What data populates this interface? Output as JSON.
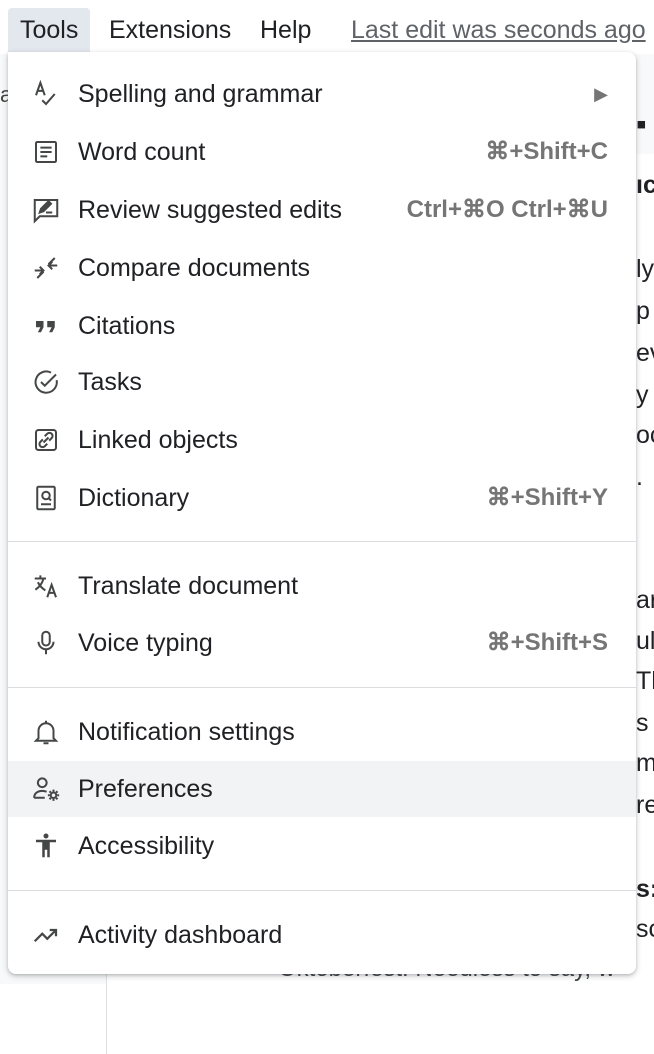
{
  "menubar": {
    "tools": "Tools",
    "extensions": "Extensions",
    "help": "Help",
    "last_edit": "Last edit was seconds ago"
  },
  "menu": {
    "items": [
      {
        "label": "Spelling and grammar",
        "shortcut": "",
        "icon": "spellcheck-icon",
        "submenu": true
      },
      {
        "label": "Word count",
        "shortcut": "⌘+Shift+C",
        "icon": "word-count-icon"
      },
      {
        "label": "Review suggested edits",
        "shortcut": "Ctrl+⌘O Ctrl+⌘U",
        "icon": "rate-review-icon"
      },
      {
        "label": "Compare documents",
        "shortcut": "",
        "icon": "compare-icon"
      },
      {
        "label": "Citations",
        "shortcut": "",
        "icon": "quote-icon"
      },
      {
        "label": "Tasks",
        "shortcut": "",
        "icon": "check-circle-icon"
      },
      {
        "label": "Linked objects",
        "shortcut": "",
        "icon": "link-icon"
      },
      {
        "label": "Dictionary",
        "shortcut": "⌘+Shift+Y",
        "icon": "book-search-icon"
      },
      {
        "label": "Translate document",
        "shortcut": "",
        "icon": "translate-icon"
      },
      {
        "label": "Voice typing",
        "shortcut": "⌘+Shift+S",
        "icon": "microphone-icon"
      },
      {
        "label": "Notification settings",
        "shortcut": "",
        "icon": "bell-icon"
      },
      {
        "label": "Preferences",
        "shortcut": "",
        "icon": "person-gear-icon",
        "highlighted": true
      },
      {
        "label": "Accessibility",
        "shortcut": "",
        "icon": "accessibility-icon"
      },
      {
        "label": "Activity dashboard",
        "shortcut": "",
        "icon": "trending-up-icon"
      }
    ],
    "submenu_arrow": "▶"
  },
  "doc_fragments": {
    "f1": "ıc",
    "f2": "ly",
    "f3": " p",
    "f4": "ev",
    "f5": " y",
    "f6": "oc",
    "f7": ".",
    "f8": "ar",
    "f9": "ul",
    "f10": "Th",
    "f11": " s",
    "f12": "m",
    "f13": "re",
    "f14": "s:",
    "f15": "sc",
    "left": "al",
    "bottom": "Oktoberfest. Needless to say, w"
  },
  "colors": {
    "menubar_active_bg": "#e3e7ee",
    "highlight_bg": "#f1f3f4",
    "shortcut_text": "#757575",
    "separator": "#dadce0"
  }
}
